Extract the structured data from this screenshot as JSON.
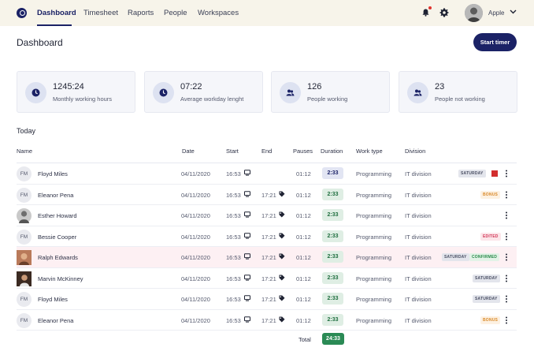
{
  "nav": {
    "items": [
      "Dashboard",
      "Timesheet",
      "Raports",
      "People",
      "Workspaces"
    ],
    "user_name": "Apple"
  },
  "header": {
    "title": "Dashboard",
    "start_timer_label": "Start timer"
  },
  "stats": [
    {
      "value": "1245:24",
      "label": "Monthly working hours",
      "icon": "clock-icon"
    },
    {
      "value": "07:22",
      "label": "Average workday lenght",
      "icon": "clock-icon"
    },
    {
      "value": "126",
      "label": "People  working",
      "icon": "people-icon"
    },
    {
      "value": "23",
      "label": "People not working",
      "icon": "people-icon"
    }
  ],
  "section_title": "Today",
  "table": {
    "headers": [
      "Name",
      "Date",
      "Start",
      "End",
      "Pauses",
      "Duration",
      "Work type",
      "Division"
    ],
    "rows": [
      {
        "initials": "FM",
        "name": "Floyd Miles",
        "date": "04/11/2020",
        "start": "16:53",
        "end": "",
        "pauses": "01:12",
        "duration": "2:33",
        "work_type": "Programming",
        "division": "IT division",
        "badges": [
          "SATURDAY"
        ]
      },
      {
        "initials": "FM",
        "name": "Eleanor Pena",
        "date": "04/11/2020",
        "start": "16:53",
        "end": "17:21",
        "pauses": "01:12",
        "duration": "2:33",
        "work_type": "Programming",
        "division": "IT division",
        "badges": [
          "BONUS"
        ]
      },
      {
        "initials": "",
        "name": "Esther Howard",
        "date": "04/11/2020",
        "start": "16:53",
        "end": "17:21",
        "pauses": "01:12",
        "duration": "2:33",
        "work_type": "Programming",
        "division": "IT division",
        "badges": []
      },
      {
        "initials": "FM",
        "name": "Bessie Cooper",
        "date": "04/11/2020",
        "start": "16:53",
        "end": "17:21",
        "pauses": "01:12",
        "duration": "2:33",
        "work_type": "Programming",
        "division": "IT division",
        "badges": [
          "EDITED"
        ]
      },
      {
        "initials": "",
        "name": "Ralph Edwards",
        "date": "04/11/2020",
        "start": "16:53",
        "end": "17:21",
        "pauses": "01:12",
        "duration": "2:33",
        "work_type": "Programming",
        "division": "IT division",
        "badges": [
          "SATURDAY",
          "CONFIRMED"
        ]
      },
      {
        "initials": "",
        "name": "Marvin McKinney",
        "date": "04/11/2020",
        "start": "16:53",
        "end": "17:21",
        "pauses": "01:12",
        "duration": "2:33",
        "work_type": "Programming",
        "division": "IT division",
        "badges": [
          "SATURDAY"
        ]
      },
      {
        "initials": "FM",
        "name": "Floyd Miles",
        "date": "04/11/2020",
        "start": "16:53",
        "end": "17:21",
        "pauses": "01:12",
        "duration": "2:33",
        "work_type": "Programming",
        "division": "IT division",
        "badges": [
          "SATURDAY"
        ]
      },
      {
        "initials": "FM",
        "name": "Eleanor Pena",
        "date": "04/11/2020",
        "start": "16:53",
        "end": "17:21",
        "pauses": "01:12",
        "duration": "2:33",
        "work_type": "Programming",
        "division": "IT division",
        "badges": [
          "BONUS"
        ]
      }
    ],
    "total_label": "Total",
    "total_value": "24:33"
  },
  "colors": {
    "brand": "#1b2266",
    "duration_bg": "#dfeee4",
    "total_bg": "#2a8a55",
    "highlight_row": "#fdf0f3"
  }
}
